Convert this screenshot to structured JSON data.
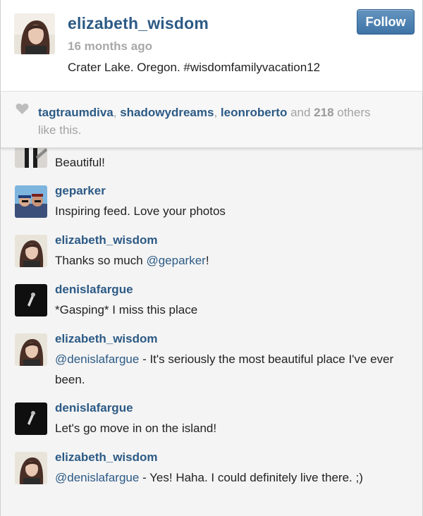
{
  "post": {
    "owner": "elizabeth_wisdom",
    "time": "16 months ago",
    "caption": "Crater Lake. Oregon. #wisdomfamilyvacation12",
    "follow_label": "Follow"
  },
  "likes": {
    "users": [
      "tagtraumdiva",
      "shadowydreams",
      "leonroberto"
    ],
    "sep1": ", ",
    "sep2": ", ",
    "and_text": " and ",
    "count": "218",
    "others_text": " others like this."
  },
  "comments": [
    {
      "user": "",
      "text": "Beautiful!"
    },
    {
      "user": "geparker",
      "text": "Inspiring feed. Love your photos"
    },
    {
      "user": "elizabeth_wisdom",
      "text_before": "Thanks so much ",
      "mention": "@geparker",
      "text_after": "!"
    },
    {
      "user": "denislafargue",
      "text": "*Gasping* I miss this place"
    },
    {
      "user": "elizabeth_wisdom",
      "mention": "@denislafargue",
      "text_after": " - It's seriously the most beautiful place I've ever been."
    },
    {
      "user": "denislafargue",
      "text": "Let's go move in on the island!"
    },
    {
      "user": "elizabeth_wisdom",
      "mention": "@denislafargue",
      "text_after": " - Yes! Haha. I could definitely live there. ;)"
    }
  ]
}
